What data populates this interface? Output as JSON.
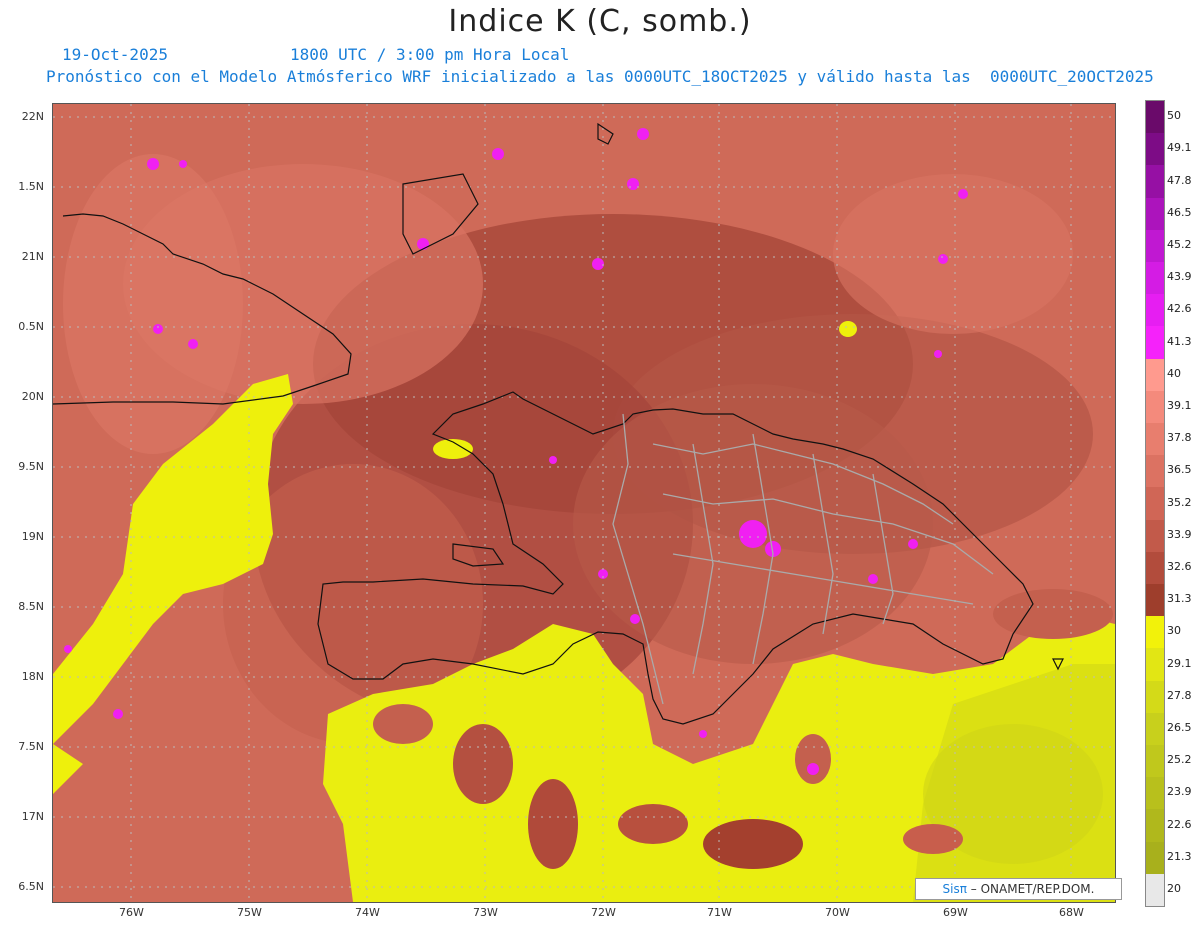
{
  "title": "Indice K (C, somb.)",
  "date": "19-Oct-2025",
  "valid_time": "1800 UTC / 3:00 pm Hora Local",
  "model_info": "Pronóstico con el Modelo Atmósferico WRF inicializado a las 0000UTC_18OCT2025 y válido hasta las  0000UTC_20OCT2025",
  "lat_labels": [
    "22N",
    "1.5N",
    "21N",
    "0.5N",
    "20N",
    "9.5N",
    "19N",
    "8.5N",
    "18N",
    "7.5N",
    "17N",
    "6.5N"
  ],
  "lon_labels": [
    "76W",
    "75W",
    "74W",
    "73W",
    "72W",
    "71W",
    "70W",
    "69W",
    "68W"
  ],
  "colorbar": {
    "labels": [
      "50",
      "49.1",
      "47.8",
      "46.5",
      "45.2",
      "43.9",
      "42.6",
      "41.3",
      "40",
      "39.1",
      "37.8",
      "36.5",
      "35.2",
      "33.9",
      "32.6",
      "31.3",
      "30",
      "29.1",
      "27.8",
      "26.5",
      "25.2",
      "23.9",
      "22.6",
      "21.3",
      "20"
    ],
    "colors": [
      "#6a0a6a",
      "#7d0c86",
      "#9610a4",
      "#ac14bc",
      "#c018d2",
      "#d41ce4",
      "#e61ef2",
      "#f522fa",
      "#ff9a8e",
      "#f48a7c",
      "#e87e6e",
      "#dc7262",
      "#d06656",
      "#c25a4a",
      "#b24c3c",
      "#9e3e2c",
      "#f2f20a",
      "#e2e614",
      "#d4da18",
      "#c8d01c",
      "#c0c81c",
      "#b8c01c",
      "#b0b81c",
      "#a8b01c",
      "#e8e8e8"
    ]
  },
  "credit": {
    "brand": "Sisπ",
    "org": " – ONAMET/REP.DOM."
  }
}
